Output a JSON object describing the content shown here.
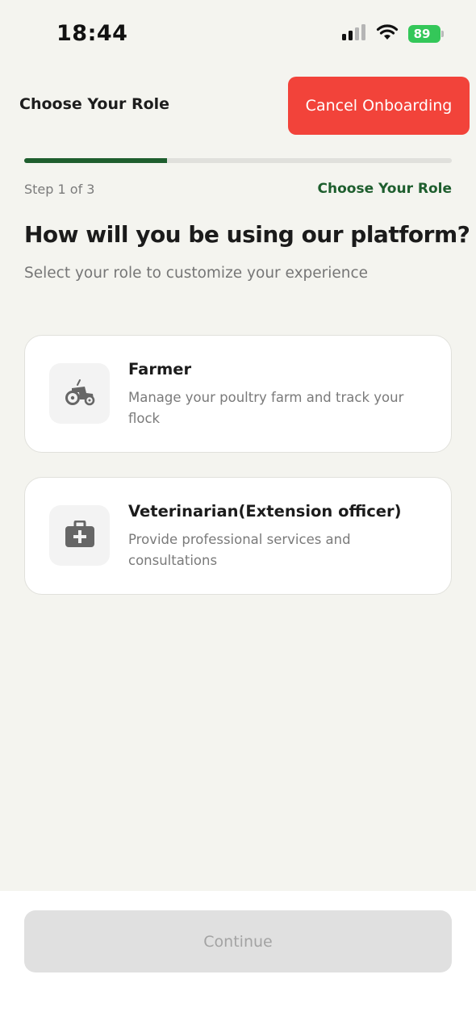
{
  "status_bar": {
    "time": "18:44",
    "battery": "89",
    "icons": [
      "cellular-signal-icon",
      "wifi-icon",
      "battery-charging-icon"
    ]
  },
  "header": {
    "title": "Choose Your Role",
    "cancel_label": "Cancel Onboarding"
  },
  "progress": {
    "step_label": "Step 1 of 3",
    "step_name": "Choose Your Role",
    "current": 1,
    "total": 3
  },
  "main": {
    "heading": "How will you be using our platform?",
    "subheading": "Select your role to customize your experience"
  },
  "roles": [
    {
      "title": "Farmer",
      "description": "Manage your poultry farm and track your flock",
      "icon": "tractor-icon"
    },
    {
      "title": "Veterinarian(Extension officer)",
      "description": "Provide professional services and consultations",
      "icon": "medical-kit-icon"
    }
  ],
  "footer": {
    "continue_label": "Continue"
  },
  "colors": {
    "accent": "#1e5e2e",
    "danger": "#f2433a",
    "background": "#f4f4ef",
    "disabled": "#e0e0e0"
  }
}
